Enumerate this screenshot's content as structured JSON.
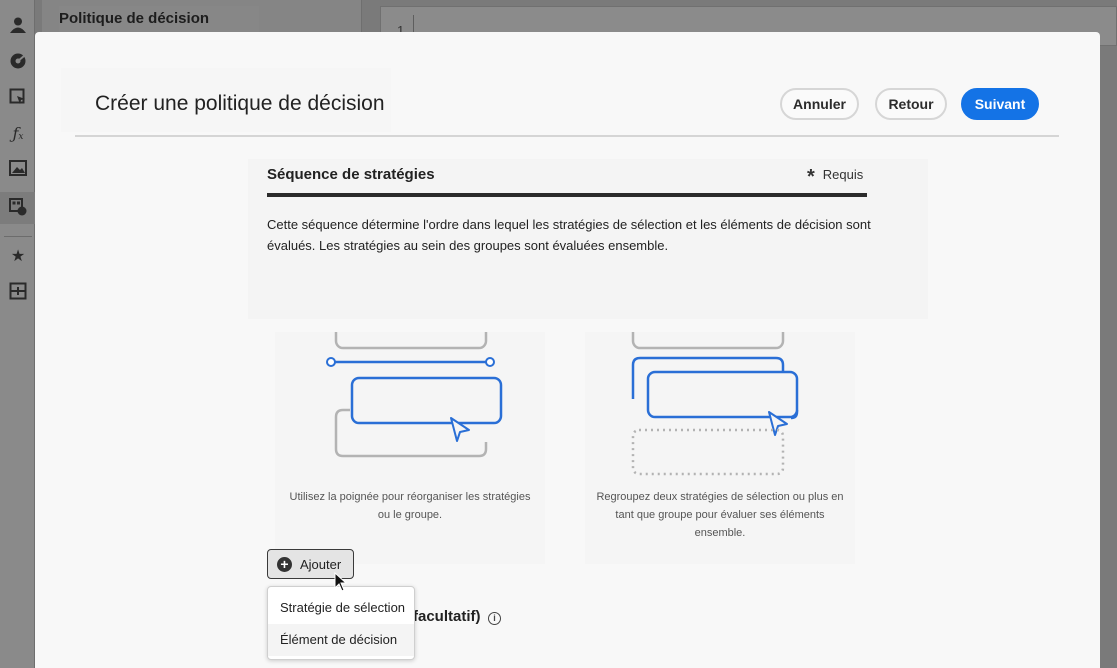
{
  "background": {
    "panel_title": "Politique de décision",
    "editor_line_number": "1",
    "rail_icons": [
      "user-icon",
      "dashboard-icon",
      "cursor-select-icon",
      "function-icon",
      "image-icon",
      "decision-icon",
      "star-icon",
      "grid-icon"
    ]
  },
  "modal": {
    "title": "Créer une politique de décision",
    "buttons": {
      "cancel": "Annuler",
      "back": "Retour",
      "next": "Suivant"
    },
    "section": {
      "title": "Séquence de stratégies",
      "required_mark": "*",
      "required_label": "Requis",
      "description": "Cette séquence détermine l'ordre dans lequel les stratégies de sélection et les éléments de décision sont évalués. Les stratégies au sein des groupes sont évaluées ensemble."
    },
    "cards": [
      {
        "caption": "Utilisez la poignée pour réorganiser les stratégies ou le groupe."
      },
      {
        "caption": "Regroupez deux stratégies de sélection ou plus en tant que groupe pour évaluer ses éléments ensemble."
      }
    ],
    "add_button": "Ajouter",
    "add_menu": [
      "Stratégie de sélection",
      "Élément de décision"
    ],
    "optional_section_fragment": "facultatif)",
    "colors": {
      "accent": "#1473e6",
      "illustration_blue": "#2a6fd6",
      "illustration_gray": "#b3b3b3"
    }
  }
}
